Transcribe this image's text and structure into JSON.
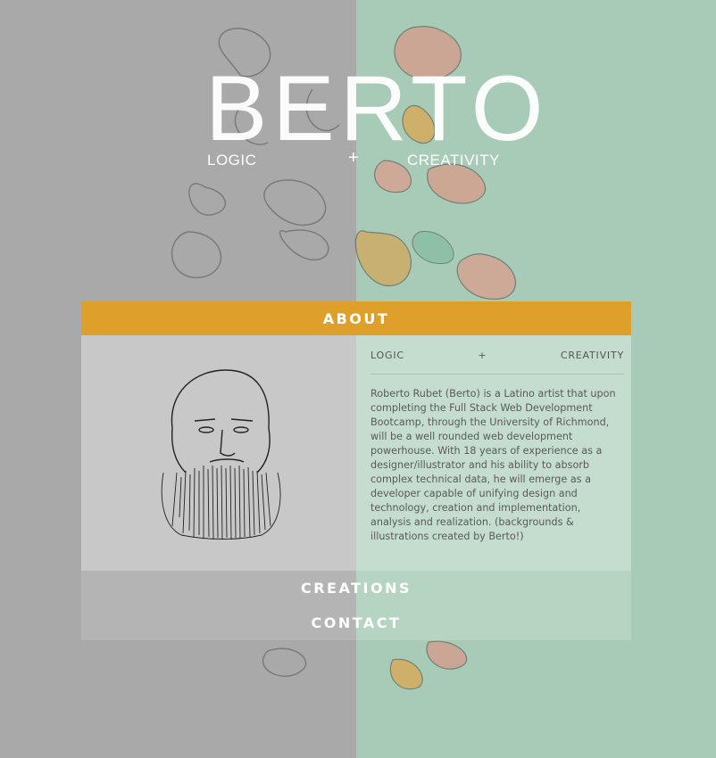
{
  "colors": {
    "left_bg": "#a9a9a9",
    "right_bg": "#a8cbb7",
    "accent": "#dfa02b"
  },
  "logo": {
    "word": "BERTO",
    "left": "LOGIC",
    "plus": "+",
    "right": "CREATIVITY"
  },
  "nav": {
    "about": "ABOUT",
    "creations": "CREATIONS",
    "contact": "CONTACT"
  },
  "about": {
    "tagline": {
      "left": "LOGIC",
      "plus": "+",
      "right": "CREATIVITY"
    },
    "bio": "Roberto Rubet (Berto) is a Latino artist that upon completing the Full Stack Web Development Bootcamp, through the University of Richmond, will be a well rounded web development powerhouse. With 18 years of experience as a designer/illustrator and his ability to absorb complex technical data, he will emerge as a developer capable of unifying design and technology, creation and implementation, analysis and realization. (backgrounds & illustrations created by Berto!)"
  }
}
